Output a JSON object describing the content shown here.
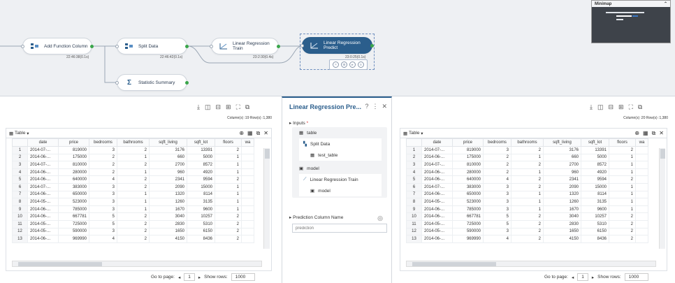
{
  "canvas": {
    "nodes": [
      {
        "id": "add-function",
        "label": "Add Function Column",
        "ts": "22:46:38(0.1s)"
      },
      {
        "id": "split-data",
        "label": "Split Data",
        "ts": "22:46:42(0.1s)"
      },
      {
        "id": "lr-train",
        "label": "Linear Regression Train",
        "ts": "23:2:30(0.4s)"
      },
      {
        "id": "lr-predict",
        "label": "Linear Regression Predict",
        "ts": "23:0:25(0.1s)"
      },
      {
        "id": "stat-summary",
        "label": "Statistic Summary",
        "ts": ""
      }
    ],
    "minimap_title": "Minimap"
  },
  "left_panel": {
    "col_info": "Column(s) :19   Row(s) :1,380",
    "table_label": "Table",
    "columns": [
      "",
      "date",
      "price",
      "bedrooms",
      "bathrooms",
      "sqft_living",
      "sqft_lot",
      "floors",
      "wa"
    ],
    "rows": [
      [
        "1",
        "2014-07-...",
        "819000",
        "3",
        "2",
        "3176",
        "13391",
        "2"
      ],
      [
        "2",
        "2014-06-...",
        "175000",
        "2",
        "1",
        "660",
        "5000",
        "1"
      ],
      [
        "3",
        "2014-07-...",
        "810000",
        "2",
        "2",
        "2700",
        "8572",
        "1"
      ],
      [
        "4",
        "2014-06-...",
        "280000",
        "2",
        "1",
        "960",
        "4920",
        "1"
      ],
      [
        "5",
        "2014-06-...",
        "640000",
        "4",
        "2",
        "2341",
        "9594",
        "2"
      ],
      [
        "6",
        "2014-07-...",
        "383000",
        "3",
        "2",
        "2090",
        "15000",
        "1"
      ],
      [
        "7",
        "2014-06-...",
        "650000",
        "3",
        "1",
        "1320",
        "8114",
        "1"
      ],
      [
        "8",
        "2014-05-...",
        "523000",
        "3",
        "1",
        "1260",
        "3135",
        "1"
      ],
      [
        "9",
        "2014-06-...",
        "785000",
        "3",
        "1",
        "1670",
        "9600",
        "1"
      ],
      [
        "10",
        "2014-06-...",
        "667781",
        "5",
        "2",
        "3040",
        "10257",
        "2"
      ],
      [
        "11",
        "2014-05-...",
        "725000",
        "5",
        "2",
        "2830",
        "5310",
        "2"
      ],
      [
        "12",
        "2014-05-...",
        "590000",
        "3",
        "2",
        "1650",
        "6150",
        "2"
      ],
      [
        "13",
        "2014-06-...",
        "969990",
        "4",
        "2",
        "4150",
        "8436",
        "2"
      ]
    ],
    "goto": "Go to page:",
    "page": "1",
    "show_rows": "Show rows:",
    "rows_per_page": "1000"
  },
  "right_panel": {
    "col_info": "Column(s) :20   Row(s) :1,380",
    "table_label": "Table",
    "goto": "Go to page:",
    "page": "1",
    "show_rows": "Show rows:",
    "rows_per_page": "1000"
  },
  "props": {
    "title": "Linear Regression Pre...",
    "inputs": "Inputs",
    "table": "table",
    "split_data": "Split Data",
    "test_table": "test_table",
    "model": "model",
    "lr_train": "Linear Regression Train",
    "model2": "model",
    "pred_col": "Prediction Column Name",
    "pred_placeholder": "prediction"
  }
}
